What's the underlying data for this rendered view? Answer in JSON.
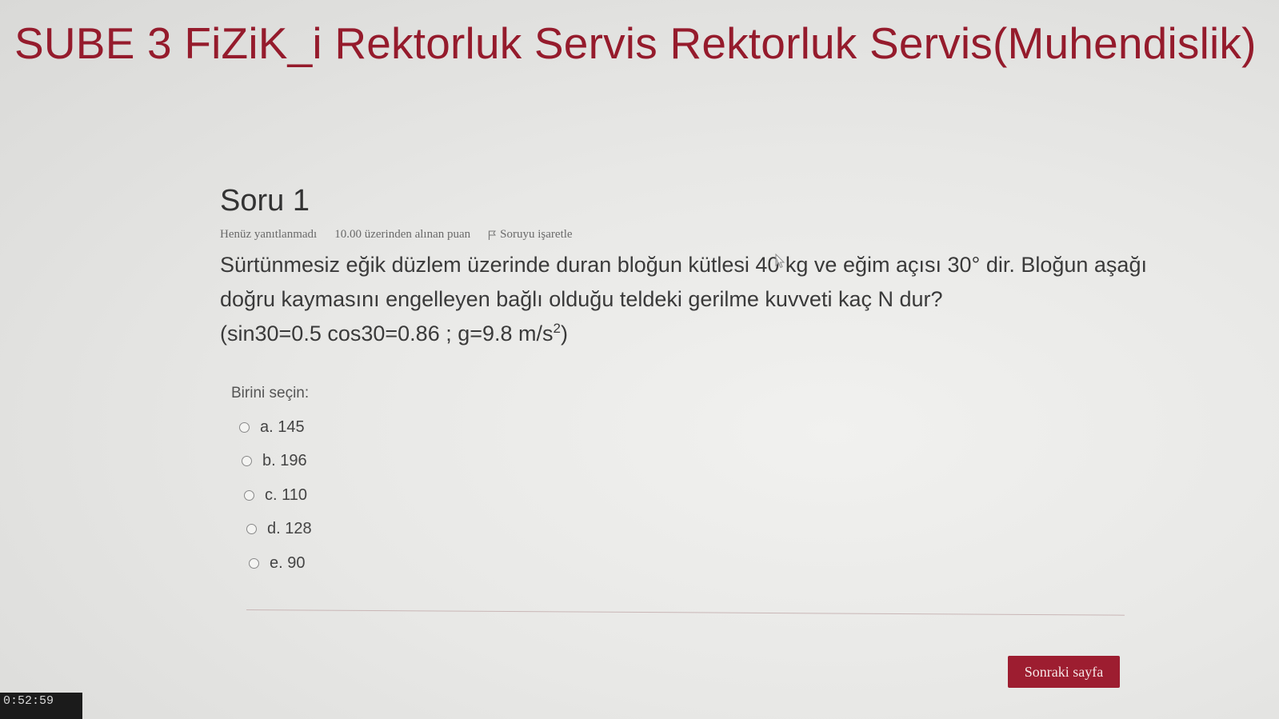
{
  "header": {
    "course_title": "SUBE 3 FiZiK_i Rektorluk Servis Rektorluk Servis(Muhendislik)"
  },
  "question": {
    "heading": "Soru 1",
    "status": "Henüz yanıtlanmadı",
    "points": "10.00 üzerinden alınan puan",
    "flag_label": "Soruyu işaretle",
    "text_main": "Sürtünmesiz eğik düzlem üzerinde duran bloğun kütlesi 40 kg ve eğim açısı 30° dir. Bloğun aşağı doğru kaymasını engelleyen bağlı olduğu teldeki gerilme kuvveti kaç N dur?",
    "text_hint_prefix": "(sin30=0.5 cos30=0.86 ;  g=9.8 m/s",
    "text_hint_exp": "2",
    "text_hint_suffix": ")",
    "prompt": "Birini seçin:",
    "answers": [
      {
        "label": "a. 145"
      },
      {
        "label": "b. 196"
      },
      {
        "label": "c. 110"
      },
      {
        "label": "d. 128"
      },
      {
        "label": "e. 90"
      }
    ]
  },
  "navigation": {
    "next_label": "Sonraki sayfa"
  },
  "timer": {
    "value": "0:52:59"
  },
  "colors": {
    "accent": "#951b2c",
    "button": "#9d1d30"
  }
}
